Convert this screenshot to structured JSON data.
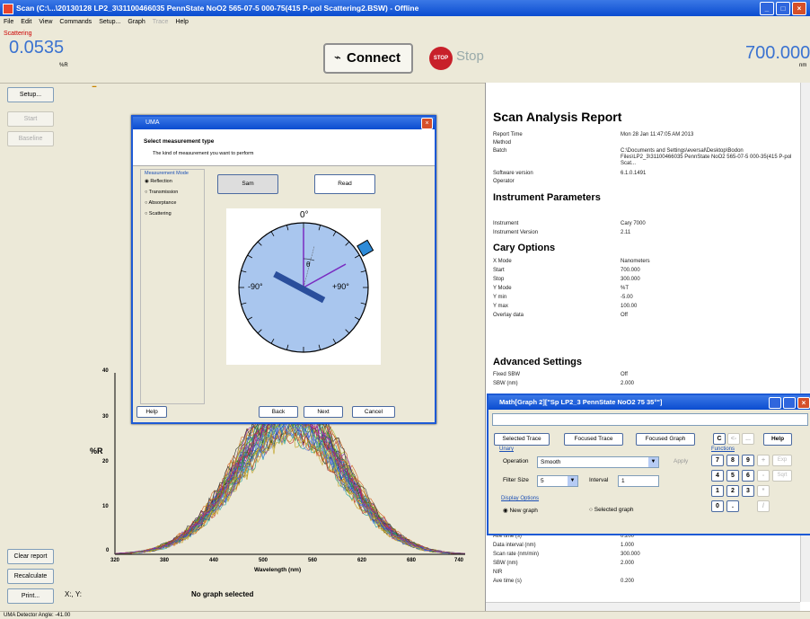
{
  "window": {
    "title": "Scan (C:\\...\\20130128 LP2_3\\31100466035 PennState NoO2 565-07-5 000-75(415 P-pol Scattering2.BSW) - Offline"
  },
  "menu": [
    "File",
    "Edit",
    "View",
    "Commands",
    "Setup...",
    "Graph",
    "Trace",
    "Help"
  ],
  "toolbar": {
    "left_readout_label": "Scattering",
    "left_readout_value": "0.0535",
    "left_readout_unit": "%R",
    "connect_label": "Connect",
    "stop_label": "Stop",
    "right_readout_value": "700.000",
    "right_readout_unit": "nm"
  },
  "sidebar": {
    "setup": "Setup...",
    "start": "Start",
    "baseline": "Baseline",
    "clear_report": "Clear report",
    "recalculate": "Recalculate",
    "print": "Print..."
  },
  "graph": {
    "xlabel": "Wavelength (nm)",
    "ylabel": "%R",
    "no_graph": "No graph selected",
    "coords": "X:, Y:",
    "y_ticks": [
      "40",
      "30",
      "20",
      "10",
      "0"
    ],
    "x_ticks": [
      "320",
      "380",
      "440",
      "500",
      "560",
      "620",
      "680",
      "740"
    ]
  },
  "wizard": {
    "title": "UMA",
    "heading": "Select measurement type",
    "subheading": "The kind of measurement you want to perform",
    "group_label": "Measurement Mode",
    "radios": [
      "Reflection",
      "Transmission",
      "Absorptance",
      "Scattering"
    ],
    "btn_sam": "Sam",
    "btn_read": "Read",
    "angle_top": "0°",
    "angle_left": "-90°",
    "angle_right": "+90°",
    "theta": "θ",
    "help": "Help",
    "back": "Back",
    "next": "Next",
    "cancel": "Cancel"
  },
  "math": {
    "title": "Math[Graph 2][\"Sp LP2_3 PennState NoO2 75 35°\"]",
    "btn_selected_trace": "Selected Trace",
    "btn_focused_trace": "Focused Trace",
    "btn_focused_graph": "Focused Graph",
    "btn_c": "C",
    "btn_left": "<-",
    "btn_dots": "...",
    "btn_help": "Help",
    "label_unary": "Unary",
    "label_operation": "Operation",
    "operation_value": "Smooth",
    "apply": "Apply",
    "label_filter": "Filter Size",
    "filter_value": "5",
    "label_interval": "Interval",
    "interval_value": "1",
    "label_display": "Display Options",
    "opt_new": "New graph",
    "opt_selected": "Selected graph",
    "label_functions": "Functions",
    "keys": [
      [
        "7",
        "8",
        "9",
        "+",
        "Exp"
      ],
      [
        "4",
        "5",
        "6",
        "-",
        "Sqrt"
      ],
      [
        "1",
        "2",
        "3",
        "*",
        ""
      ],
      [
        "0",
        ".",
        "",
        "/",
        ""
      ]
    ]
  },
  "report": {
    "title": "Scan Analysis Report",
    "meta": [
      {
        "k": "Report Time",
        "v": "Mon 28 Jan 11:47:05 AM 2013"
      },
      {
        "k": "Method",
        "v": ""
      },
      {
        "k": "Batch",
        "v": "C:\\Documents and Settings\\eversal\\Desktop\\Bodon Files\\LP2_3\\31100466035 PennState NoO2 565-07-5 000-35(415 P-pol Scat..."
      },
      {
        "k": "Software version",
        "v": "6.1.0.1491"
      },
      {
        "k": "Operator",
        "v": ""
      }
    ],
    "instrument_title": "Instrument Parameters",
    "instrument": [
      {
        "k": "Instrument",
        "v": "Cary 7000"
      },
      {
        "k": "Instrument Version",
        "v": "2.11"
      }
    ],
    "cary_title": "Cary Options",
    "cary": [
      {
        "k": "X Mode",
        "v": "Nanometers"
      },
      {
        "k": "Start",
        "v": "700.000"
      },
      {
        "k": "Stop",
        "v": "300.000"
      },
      {
        "k": "Y Mode",
        "v": "%T"
      },
      {
        "k": "Y min",
        "v": "-5.00"
      },
      {
        "k": "Y max",
        "v": "100.00"
      },
      {
        "k": "Overlay data",
        "v": "Off"
      }
    ],
    "adv_title": "Advanced Settings",
    "adv": [
      {
        "k": "Fixed SBW",
        "v": "Off"
      },
      {
        "k": "SBW (nm)",
        "v": "2.000"
      }
    ],
    "bottom": [
      {
        "k": "Ave time (s)",
        "v": "0.200"
      },
      {
        "k": "Data interval (nm)",
        "v": "1.000"
      },
      {
        "k": "Scan rate (nm/min)",
        "v": "300.000"
      },
      {
        "k": "SBW (nm)",
        "v": "2.000"
      },
      {
        "k": "NIR",
        "v": ""
      },
      {
        "k": "Ave time (s)",
        "v": "0.200"
      }
    ]
  },
  "status": {
    "text": "UMA Detector Angle: -41.00"
  }
}
